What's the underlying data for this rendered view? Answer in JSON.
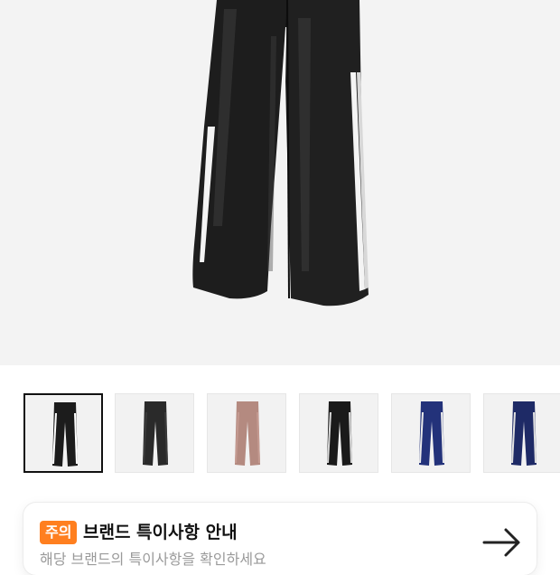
{
  "product": {
    "main_image": "black-track-pants-photo",
    "gallery": [
      {
        "image": "black-track-pants-white-stripe",
        "color": "#1c1c1c",
        "stripe": "#ffffff",
        "selected": true
      },
      {
        "image": "black-track-pants",
        "color": "#2a2a2a",
        "stripe": "#3a3a3a",
        "selected": false
      },
      {
        "image": "pink-track-pants",
        "color": "#b48a80",
        "stripe": "#c49a90",
        "selected": false
      },
      {
        "image": "black-track-pants-grey-stripe",
        "color": "#1a1a1a",
        "stripe": "#d8d8d8",
        "selected": false
      },
      {
        "image": "navy-track-pants",
        "color": "#23327a",
        "stripe": "#eaeaea",
        "selected": false
      },
      {
        "image": "navy-track-pants-2",
        "color": "#1e2a66",
        "stripe": "#e0e0e0",
        "selected": false
      }
    ]
  },
  "notice": {
    "badge": "주의",
    "title": "브랜드 특이사항 안내",
    "subtitle": "해당 브랜드의 특이사항을 확인하세요",
    "arrow_icon": "arrow-right-icon"
  },
  "colors": {
    "badge": "#ff7f1f",
    "hero_bg": "#f3f3f3"
  }
}
